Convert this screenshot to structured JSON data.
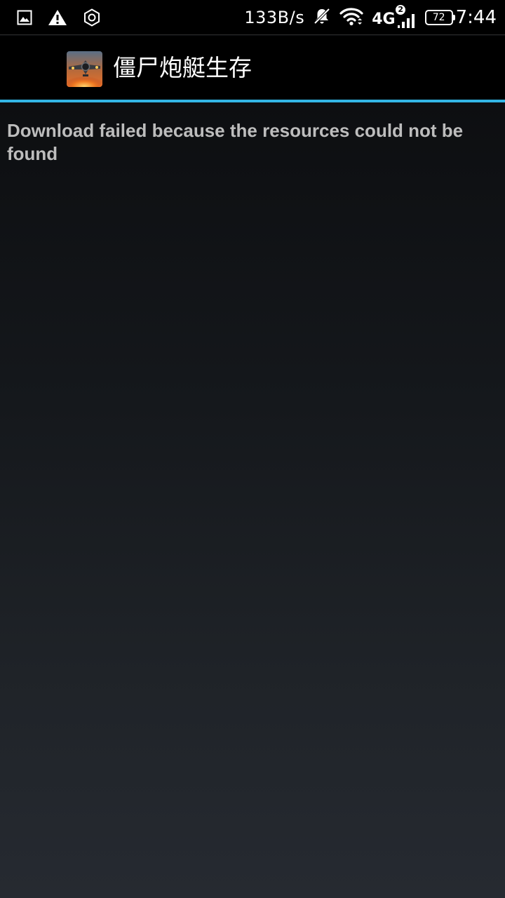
{
  "status_bar": {
    "left_icons": [
      "image-icon",
      "warning-icon",
      "hexagon-settings-icon"
    ],
    "net_speed": "133B/s",
    "network_type": "4G",
    "sim_slot": "2",
    "battery_level": "72",
    "time": "7:44",
    "right_icons": [
      "mute-bell-icon",
      "wifi-icon",
      "cell-signal-icon",
      "battery-icon"
    ]
  },
  "action_bar": {
    "app_icon": "game-airplane-icon",
    "title": "僵尸炮艇生存"
  },
  "colors": {
    "accent_divider": "#33b5e5",
    "message_text": "#bdbdbd"
  },
  "content": {
    "message": "Download failed because the resources could not be found"
  }
}
